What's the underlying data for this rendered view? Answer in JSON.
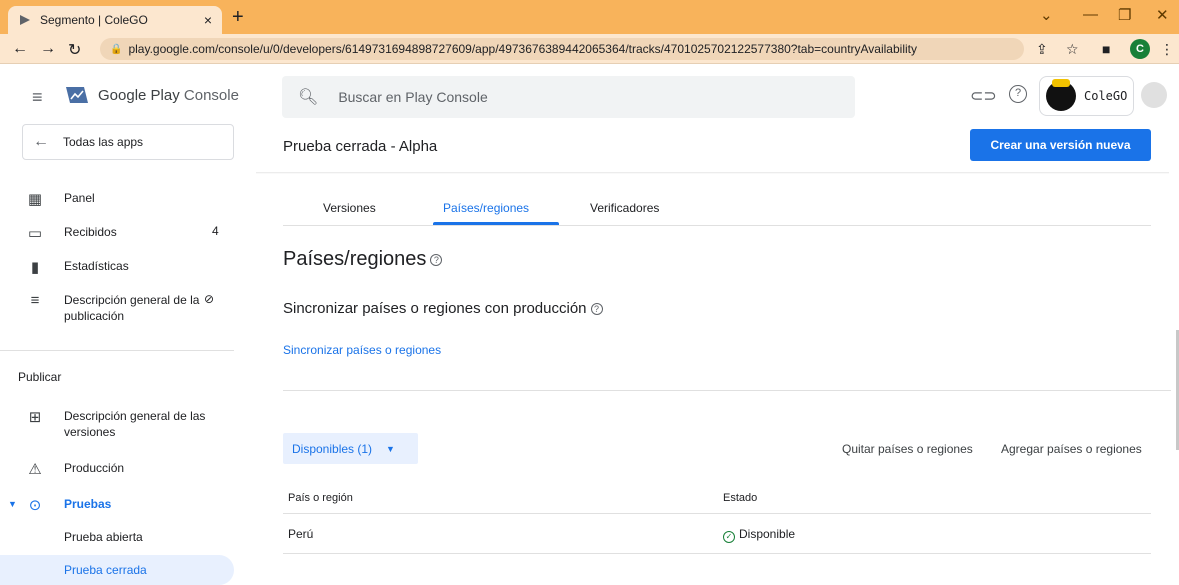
{
  "browser": {
    "tab_title": "Segmento | ColeGO",
    "tab_close": "×",
    "new_tab": "+",
    "url": "play.google.com/console/u/0/developers/6149731694898727609/app/4973676389442065364/tracks/4701025702122577380?tab=countryAvailability",
    "profile_initial": "C"
  },
  "header": {
    "brand_main": "Google Play",
    "brand_suffix": "Console",
    "search_placeholder": "Buscar en Play Console",
    "account_name": "ColeGO"
  },
  "sidebar": {
    "all_apps": "Todas las apps",
    "items": [
      {
        "label": "Panel"
      },
      {
        "label": "Recibidos",
        "count": "4"
      },
      {
        "label": "Estadísticas"
      },
      {
        "label": "Descripción general de la publicación"
      }
    ],
    "section_title": "Publicar",
    "publish_items": [
      {
        "label": "Descripción general de las versiones"
      },
      {
        "label": "Producción"
      },
      {
        "label": "Pruebas"
      }
    ],
    "sub_items": [
      {
        "label": "Prueba abierta"
      },
      {
        "label": "Prueba cerrada"
      }
    ]
  },
  "main": {
    "page_title": "Prueba cerrada - Alpha",
    "create_button": "Crear una versión nueva",
    "tabs": [
      {
        "label": "Versiones"
      },
      {
        "label": "Países/regiones"
      },
      {
        "label": "Verificadores"
      }
    ],
    "heading": "Países/regiones",
    "sync_heading": "Sincronizar países o regiones con producción",
    "sync_link": "Sincronizar países o regiones",
    "available_button": "Disponibles (1)",
    "remove_link": "Quitar países o regiones",
    "add_link": "Agregar países o regiones",
    "table": {
      "columns": [
        "País o región",
        "Estado"
      ],
      "rows": [
        {
          "country": "Perú",
          "status": "Disponible"
        }
      ]
    }
  },
  "colors": {
    "accent": "#1a73e8",
    "tabbar": "#f8b35b",
    "success": "#188038"
  }
}
